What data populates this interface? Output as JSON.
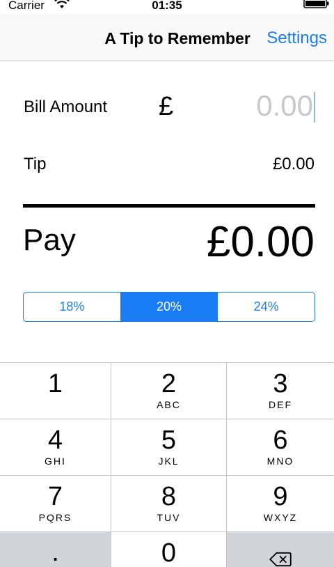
{
  "status_bar": {
    "carrier": "Carrier",
    "time": "01:35",
    "wifi_icon": "wifi-icon",
    "battery_icon": "battery-icon"
  },
  "nav": {
    "title": "A Tip to Remember",
    "settings_label": "Settings"
  },
  "bill": {
    "label": "Bill Amount",
    "currency": "£",
    "placeholder": "0.00"
  },
  "tip": {
    "label": "Tip",
    "value": "£0.00"
  },
  "pay": {
    "label": "Pay",
    "value": "£0.00"
  },
  "tip_options": {
    "segments": [
      "18%",
      "20%",
      "24%"
    ],
    "selected": "20%"
  },
  "keypad": {
    "keys": [
      {
        "digit": "1",
        "letters": ""
      },
      {
        "digit": "2",
        "letters": "ABC"
      },
      {
        "digit": "3",
        "letters": "DEF"
      },
      {
        "digit": "4",
        "letters": "GHI"
      },
      {
        "digit": "5",
        "letters": "JKL"
      },
      {
        "digit": "6",
        "letters": "MNO"
      },
      {
        "digit": "7",
        "letters": "PQRS"
      },
      {
        "digit": "8",
        "letters": "TUV"
      },
      {
        "digit": "9",
        "letters": "WXYZ"
      },
      {
        "digit": ".",
        "letters": ""
      },
      {
        "digit": "0",
        "letters": ""
      }
    ],
    "delete_icon": "backspace-icon"
  },
  "colors": {
    "accent": "#1a7cf4",
    "keypad_dark": "#d1d4d9",
    "placeholder": "#c7c7cd"
  }
}
